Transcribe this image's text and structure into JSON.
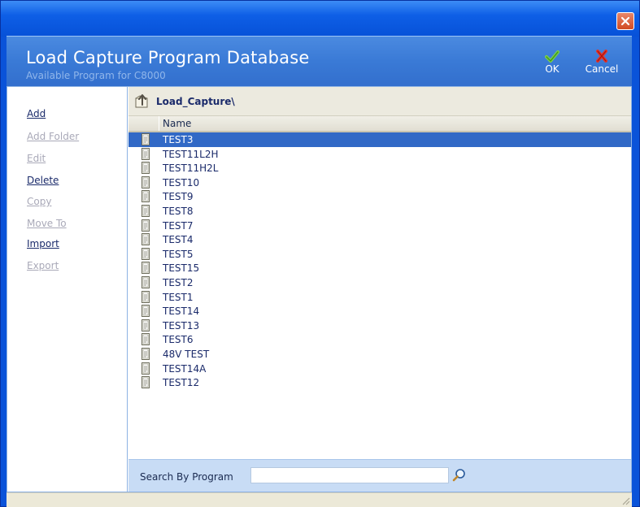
{
  "header": {
    "title": "Load Capture Program Database",
    "subtitle": "Available Program for C8000",
    "ok_label": "OK",
    "cancel_label": "Cancel"
  },
  "sidebar": {
    "items": [
      {
        "label": "Add",
        "enabled": true
      },
      {
        "label": "Add Folder",
        "enabled": false
      },
      {
        "label": "Edit",
        "enabled": false
      },
      {
        "label": "Delete",
        "enabled": true
      },
      {
        "label": "Copy",
        "enabled": false
      },
      {
        "label": "Move To",
        "enabled": false
      },
      {
        "label": "Import",
        "enabled": true
      },
      {
        "label": "Export",
        "enabled": false
      }
    ]
  },
  "browser": {
    "path": "Load_Capture\\",
    "column_name": "Name",
    "selected": "TEST3",
    "rows": [
      "TEST3",
      "TEST11L2H",
      "TEST11H2L",
      "TEST10",
      "TEST9",
      "TEST8",
      "TEST7",
      "TEST4",
      "TEST5",
      "TEST15",
      "TEST2",
      "TEST1",
      "TEST14",
      "TEST13",
      "TEST6",
      "48V TEST",
      "TEST14A",
      "TEST12"
    ]
  },
  "search": {
    "label": "Search By Program",
    "value": "",
    "placeholder": ""
  },
  "icons": {
    "close": "close-icon",
    "ok": "checkmark-icon",
    "cancel": "x-icon",
    "folder_up": "folder-up-icon",
    "file": "document-icon",
    "search": "magnifier-icon",
    "resize": "resize-grip-icon"
  },
  "colors": {
    "title_blue": "#0a53d9",
    "header_blue": "#3a7ad6",
    "selection": "#3169c6",
    "search_bg": "#c8dcf5"
  }
}
